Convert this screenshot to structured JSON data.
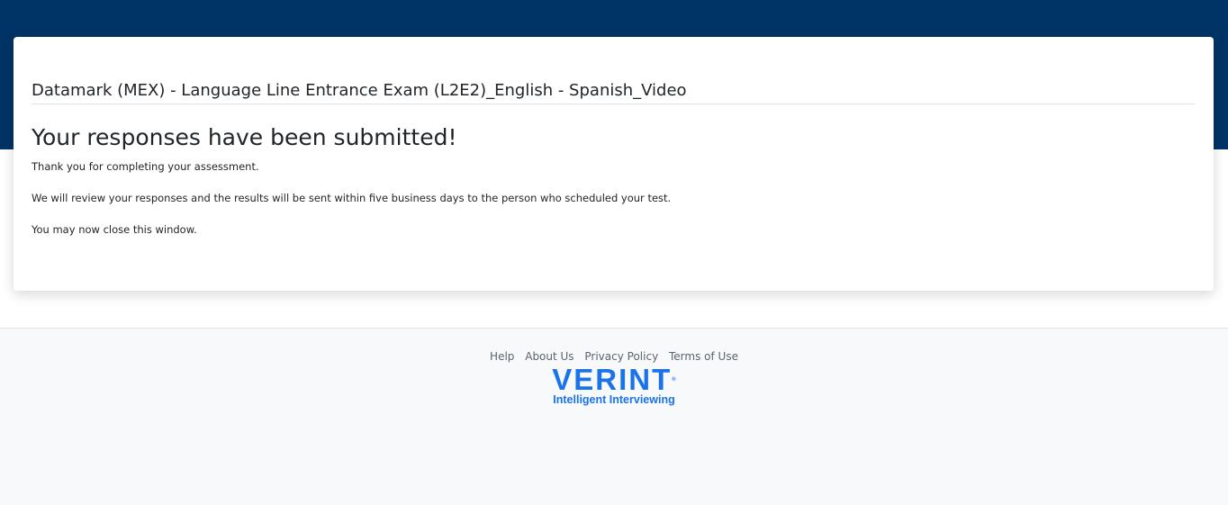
{
  "header": {
    "background_color": "#003466"
  },
  "card": {
    "exam_title": "Datamark (MEX) - Language Line Entrance Exam (L2E2)_English - Spanish_Video",
    "headline": "Your responses have been submitted!",
    "messages": [
      "Thank you for completing your assessment.",
      "We will review your responses and the results will be sent within five business days to the person who scheduled your test.",
      "You may now close this window."
    ]
  },
  "footer": {
    "links": [
      "Help",
      "About Us",
      "Privacy Policy",
      "Terms of Use"
    ],
    "logo": {
      "wordmark": "VERINT",
      "registered_mark": "®",
      "tagline": "Intelligent Interviewing",
      "color": "#1a73e8"
    }
  }
}
